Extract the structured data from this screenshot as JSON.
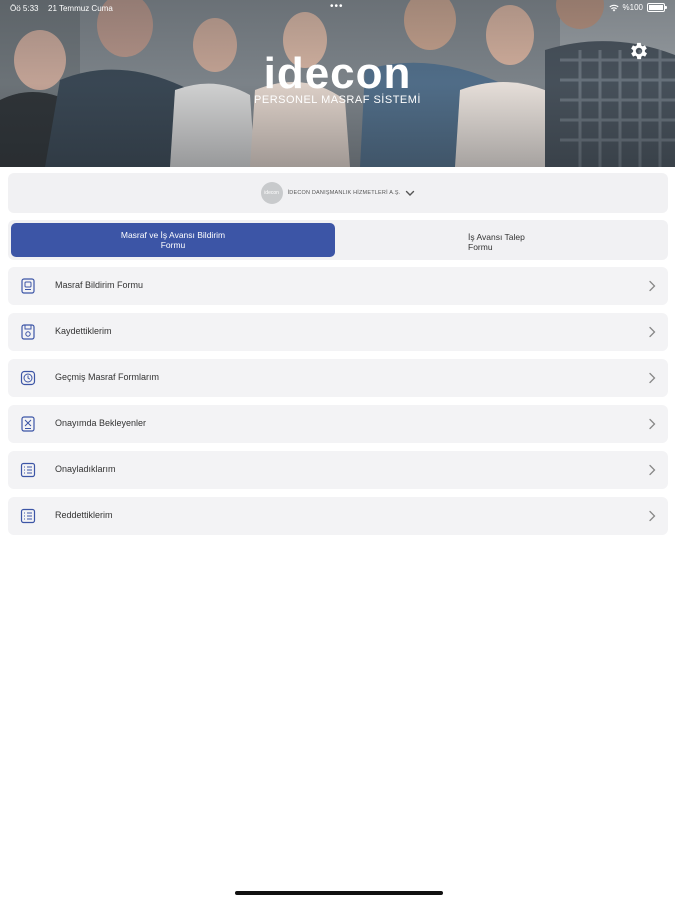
{
  "status_bar": {
    "time": "Öö 5:33",
    "date": "21 Temmuz Cuma",
    "dots": "•••",
    "battery": "%100",
    "battery_level": 1.0
  },
  "header": {
    "logo_text": "idecon",
    "subtitle": "PERSONEL MASRAF SİSTEMİ",
    "settings_icon": "gear-icon"
  },
  "company": {
    "logo_text": "idecon",
    "name": "İDECON DANIŞMANLIK HİZMETLERİ A.Ş.",
    "icon": "chevron-down-icon"
  },
  "tabs": [
    {
      "label": "Masraf ve İş Avansı Bildirim Formu",
      "active": true
    },
    {
      "label": "İş Avansı Talep Formu",
      "active": false
    }
  ],
  "menu": [
    {
      "label": "Masraf Bildirim Formu",
      "icon": "document-icon"
    },
    {
      "label": "Kaydettiklerim",
      "icon": "saved-document-icon"
    },
    {
      "label": "Geçmiş Masraf Formlarım",
      "icon": "history-icon"
    },
    {
      "label": "Onayımda Bekleyenler",
      "icon": "pending-approval-icon"
    },
    {
      "label": "Onayladıklarım",
      "icon": "approved-list-icon"
    },
    {
      "label": "Reddettiklerim",
      "icon": "rejected-list-icon"
    }
  ],
  "colors": {
    "accent": "#3c55a6",
    "card_bg": "#f3f3f5"
  }
}
